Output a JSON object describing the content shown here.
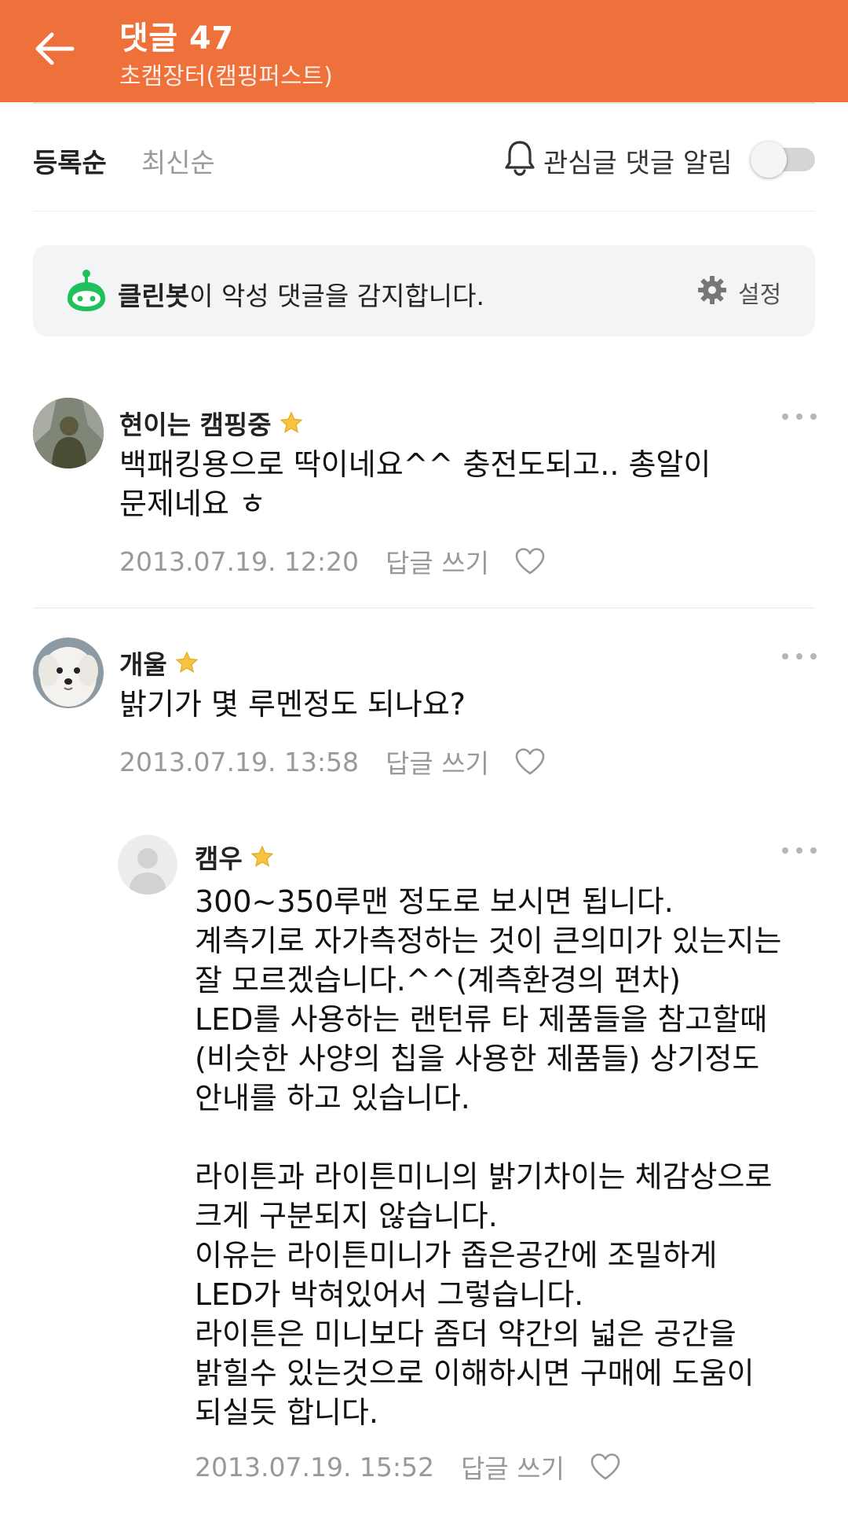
{
  "header": {
    "title": "댓글 47",
    "subtitle": "초캠장터(캠핑퍼스트)"
  },
  "sort": {
    "options": [
      "등록순",
      "최신순"
    ],
    "selected": "등록순",
    "alarm_label": "관심글 댓글 알림",
    "alarm_enabled": false
  },
  "cleanbot": {
    "name": "클린봇",
    "message": "이 악성 댓글을 감지합니다.",
    "settings_label": "설정"
  },
  "comments": [
    {
      "author": "현이는 캠핑중",
      "badge_icon": "star-icon",
      "text": "백패킹용으로 딱이네요^^ 충전도되고.. 총알이\n문제네요 ㅎ",
      "date": "2013.07.19. 12:20",
      "reply_label": "답글 쓰기"
    },
    {
      "author": "개울",
      "badge_icon": "star-icon",
      "text": "밝기가 몇 루멘정도 되나요?",
      "date": "2013.07.19. 13:58",
      "reply_label": "답글 쓰기"
    },
    {
      "author": "캠우",
      "badge_icon": "star-icon",
      "text": "300~350루맨 정도로 보시면 됩니다.\n계측기로 자가측정하는 것이 큰의미가 있는지는\n잘 모르겠습니다.^^(계측환경의 편차)\nLED를 사용하는 랜턴류 타 제품들을 참고할때\n(비슷한 사양의 칩을 사용한 제품들) 상기정도\n안내를 하고 있습니다.\n\n라이튼과 라이튼미니의 밝기차이는 체감상으로\n크게 구분되지 않습니다.\n이유는 라이튼미니가 좁은공간에 조밀하게\nLED가 박혀있어서 그렇습니다.\n라이튼은 미니보다 좀더 약간의 넓은 공간을\n밝힐수 있는것으로 이해하시면 구매에 도움이\n되실듯 합니다.",
      "date": "2013.07.19. 15:52",
      "reply_label": "답글 쓰기",
      "is_reply": true
    }
  ],
  "colors": {
    "header_bg": "#ee703a",
    "cleanbot_green": "#1fc15a",
    "star": "#f6c342"
  }
}
